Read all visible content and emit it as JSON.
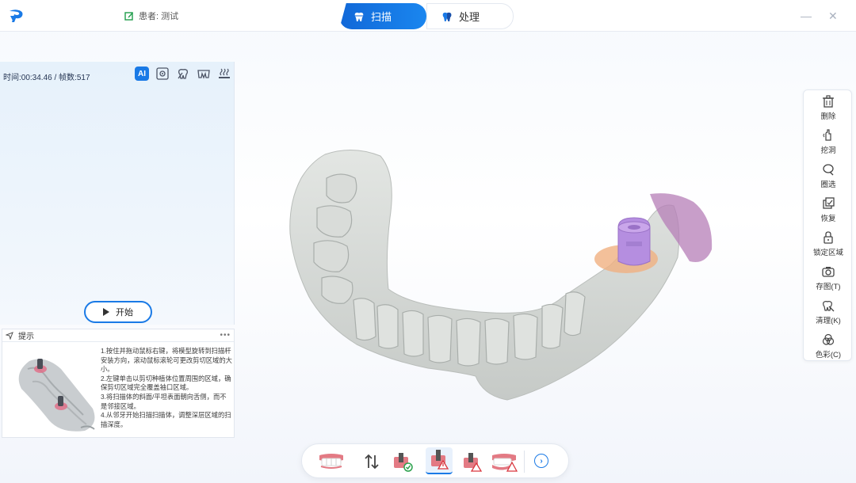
{
  "titlebar": {
    "patient": "患者: 测试",
    "tabs": [
      {
        "label": "扫描",
        "active": true
      },
      {
        "label": "处理",
        "active": false
      }
    ],
    "minimize": "—",
    "close": "✕"
  },
  "left_panel": {
    "stats": "时间:00:34.46 / 帧数:517",
    "ai_label": "AI",
    "start_label": "开始"
  },
  "tip": {
    "title": "提示",
    "more": "•••",
    "lines": [
      "1.按住并拖动鼠标右键，将模型旋转到扫描杆安装方向，滚动鼠标滚轮可更改剪切区域的大小。",
      "2.左键单击以剪切种植体位置周围的区域，确保剪切区域完全覆盖袖口区域。",
      "3.将扫描体的斜面/平坦表面朝向舌侧，而不是邻接区域。",
      "4.从邻牙开始扫描扫描体，调整深层区域的扫描深度。"
    ]
  },
  "right_toolbar": {
    "items": [
      {
        "label": "删除",
        "icon": "trash-icon"
      },
      {
        "label": "挖洞",
        "icon": "dig-hole-icon"
      },
      {
        "label": "圈选",
        "icon": "lasso-icon"
      },
      {
        "label": "恢复",
        "icon": "restore-icon"
      },
      {
        "label": "锁定区域",
        "icon": "lock-icon"
      },
      {
        "label": "存图(T)",
        "icon": "camera-icon"
      },
      {
        "label": "清理(K)",
        "icon": "clean-icon"
      },
      {
        "label": "色彩(C)",
        "icon": "color-icon"
      }
    ]
  },
  "bottom_toolbar": {
    "next": "›"
  },
  "colors": {
    "accent": "#1a7ae6",
    "model": "#d6d9d6",
    "scanbody": "#b58ee0",
    "gum": "#f0b081"
  }
}
